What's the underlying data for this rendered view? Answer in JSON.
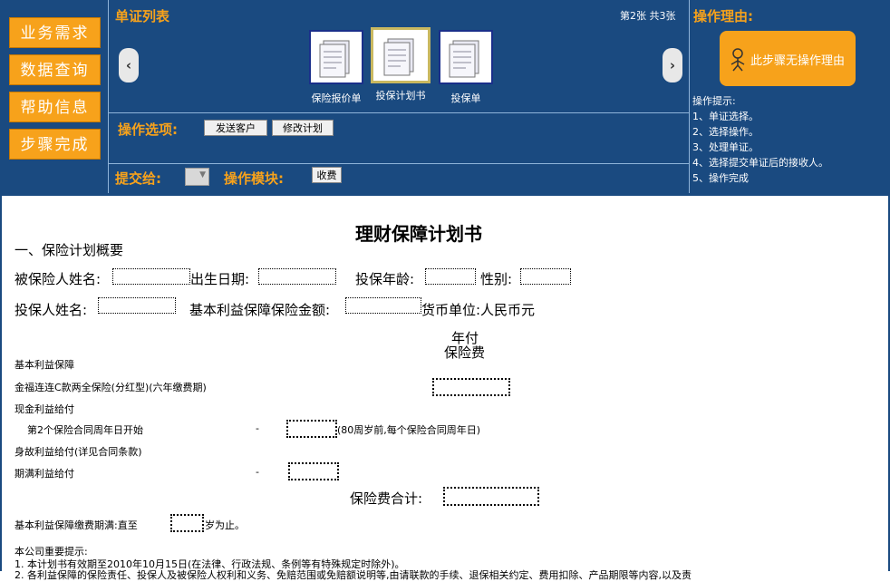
{
  "sidebar": {
    "items": [
      {
        "label": "业务需求"
      },
      {
        "label": "数据查询"
      },
      {
        "label": "帮助信息"
      },
      {
        "label": "步骤完成"
      }
    ]
  },
  "docs_panel": {
    "title": "单证列表",
    "page_info": "第2张 共3张",
    "docs": [
      {
        "label": "保险报价单"
      },
      {
        "label": "投保计划书"
      },
      {
        "label": "投保单"
      }
    ],
    "options_label": "操作选项:",
    "buttons": [
      "发送客户",
      "修改计划"
    ],
    "submit_label": "提交给:",
    "module_label": "操作模块:",
    "module_button": "收费"
  },
  "reason_panel": {
    "title": "操作理由:",
    "button": "此步骤无操作理由",
    "tips_title": "操作提示:",
    "tips": [
      "1、单证选择。",
      "2、选择操作。",
      "3、处理单证。",
      "4、选择提交单证后的接收人。",
      "5、操作完成"
    ]
  },
  "document": {
    "title": "理财保障计划书",
    "section1": "一、保险计划概要",
    "insured_name": "被保险人姓名:",
    "birth_date": "出生日期:",
    "insured_age": "投保年龄:",
    "gender": "性别:",
    "applicant_name": "投保人姓名:",
    "sum_insured": "基本利益保障保险金额:",
    "currency": "货币单位:人民币元",
    "annual_premium_1": "年付",
    "annual_premium_2": "保险费",
    "basic_benefit": "基本利益保障",
    "product": "金福连连C款两全保险(分红型)(六年缴费期)",
    "cash_benefit": "现金利益给付",
    "cash_start": "第2个保险合同周年日开始",
    "dash1": "-",
    "cash_note": "(80周岁前,每个保险合同周年日)",
    "death_benefit": "身故利益给付(详见合同条款)",
    "maturity_benefit": "期满利益给付",
    "dash2": "-",
    "total_premium": "保险费合计:",
    "payment_until": "基本利益保障缴费期满:直至",
    "age_until": "岁为止。",
    "notice_title": "本公司重要提示:",
    "notice_1": "1. 本计划书有效期至2010年10月15日(在法律、行政法规、条例等有特殊规定时除外)。",
    "notice_2": "2. 各利益保障的保险责任、投保人及被保险人权利和义务、免赔范围或免赔额说明等,由请联款的手续、退保相关约定、费用扣除、产品期限等内容,以及责"
  },
  "colors": {
    "panel_bg": "#1a4a80",
    "accent_orange": "#f7a21b"
  }
}
